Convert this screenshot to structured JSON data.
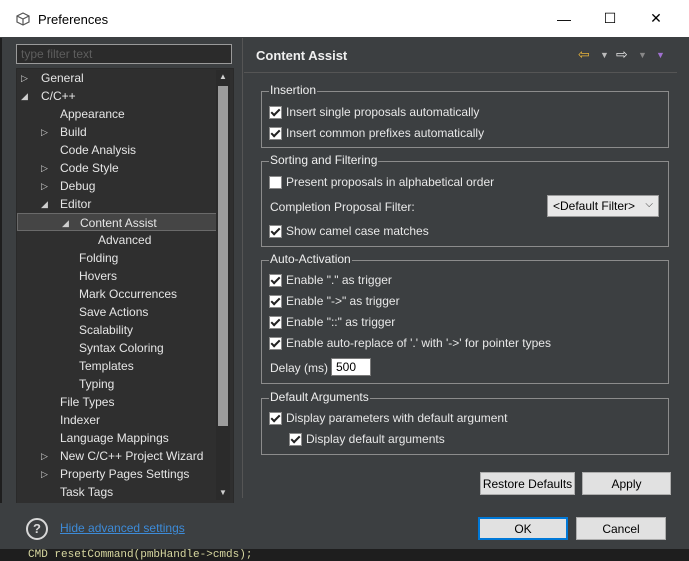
{
  "window": {
    "title": "Preferences"
  },
  "filter": {
    "placeholder": "type filter text"
  },
  "tree": [
    {
      "label": "General",
      "level": 0,
      "arrow": "▷"
    },
    {
      "label": "C/C++",
      "level": 0,
      "arrow": "◢"
    },
    {
      "label": "Appearance",
      "level": 1,
      "arrow": ""
    },
    {
      "label": "Build",
      "level": 1,
      "arrow": "▷"
    },
    {
      "label": "Code Analysis",
      "level": 1,
      "arrow": ""
    },
    {
      "label": "Code Style",
      "level": 1,
      "arrow": "▷"
    },
    {
      "label": "Debug",
      "level": 1,
      "arrow": "▷"
    },
    {
      "label": "Editor",
      "level": 1,
      "arrow": "◢"
    },
    {
      "label": "Content Assist",
      "level": 2,
      "arrow": "◢",
      "selected": true
    },
    {
      "label": "Advanced",
      "level": 3,
      "arrow": ""
    },
    {
      "label": "Folding",
      "level": 2,
      "arrow": ""
    },
    {
      "label": "Hovers",
      "level": 2,
      "arrow": ""
    },
    {
      "label": "Mark Occurrences",
      "level": 2,
      "arrow": ""
    },
    {
      "label": "Save Actions",
      "level": 2,
      "arrow": ""
    },
    {
      "label": "Scalability",
      "level": 2,
      "arrow": ""
    },
    {
      "label": "Syntax Coloring",
      "level": 2,
      "arrow": ""
    },
    {
      "label": "Templates",
      "level": 2,
      "arrow": ""
    },
    {
      "label": "Typing",
      "level": 2,
      "arrow": ""
    },
    {
      "label": "File Types",
      "level": 1,
      "arrow": ""
    },
    {
      "label": "Indexer",
      "level": 1,
      "arrow": ""
    },
    {
      "label": "Language Mappings",
      "level": 1,
      "arrow": ""
    },
    {
      "label": "New C/C++ Project Wizard",
      "level": 1,
      "arrow": "▷"
    },
    {
      "label": "Property Pages Settings",
      "level": 1,
      "arrow": "▷"
    },
    {
      "label": "Task Tags",
      "level": 1,
      "arrow": ""
    }
  ],
  "page": {
    "title": "Content Assist"
  },
  "groups": {
    "insertion": {
      "title": "Insertion",
      "opt1": "Insert single proposals automatically",
      "opt2": "Insert common prefixes automatically"
    },
    "sorting": {
      "title": "Sorting and Filtering",
      "opt1": "Present proposals in alphabetical order",
      "filter_label": "Completion Proposal Filter:",
      "filter_value": "<Default Filter>",
      "opt2": "Show camel case matches"
    },
    "auto": {
      "title": "Auto-Activation",
      "opt1": "Enable \".\" as trigger",
      "opt2": "Enable \"->\" as trigger",
      "opt3": "Enable \"::\" as trigger",
      "opt4": "Enable auto-replace of '.' with '->' for pointer types",
      "delay_label": "Delay (ms)",
      "delay_value": "500"
    },
    "default_args": {
      "title": "Default Arguments",
      "opt1": "Display parameters with default argument",
      "opt2": "Display default arguments"
    }
  },
  "buttons": {
    "restore": "Restore Defaults",
    "apply": "Apply",
    "ok": "OK",
    "cancel": "Cancel"
  },
  "footer": {
    "hide_advanced": "Hide advanced settings"
  },
  "background_code": "CMD resetCommand(pmbHandle->cmds);",
  "icons": {
    "back": "back-arrow-icon",
    "forward": "forward-arrow-icon",
    "menu": "view-menu-icon",
    "help": "help-icon"
  },
  "colors": {
    "accent": "#0078d7",
    "link": "#3d8bd8",
    "back_arrow": "#e8b43a"
  }
}
